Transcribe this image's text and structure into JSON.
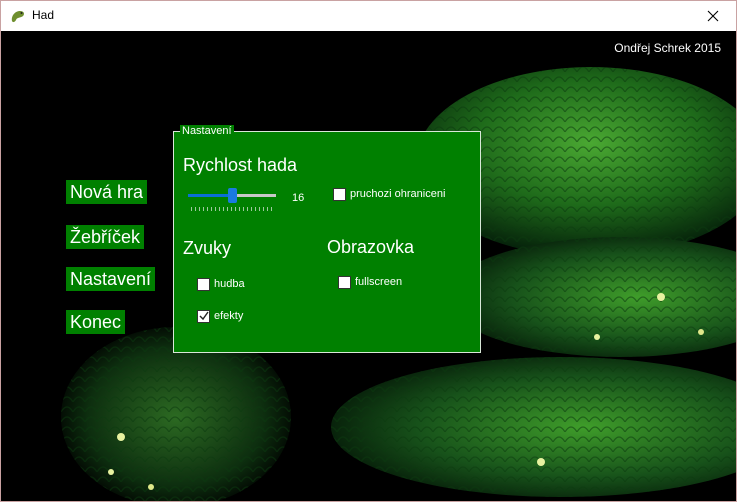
{
  "window": {
    "title": "Had",
    "close_glyph": "✕"
  },
  "author": "Ondřej Schrek 2015",
  "menu": [
    {
      "label": "Nová hra"
    },
    {
      "label": "Žebříček"
    },
    {
      "label": "Nastavení"
    },
    {
      "label": "Konec"
    }
  ],
  "settings": {
    "legend": "Nastavení",
    "speed": {
      "label": "Rychlost hada",
      "value": "16",
      "fraction": 0.5
    },
    "border_checkbox": {
      "label": "pruchozi ohraniceni",
      "checked": false
    },
    "sounds": {
      "label": "Zvuky",
      "music": {
        "label": "hudba",
        "checked": false
      },
      "effects": {
        "label": "efekty",
        "checked": true
      }
    },
    "screen": {
      "label": "Obrazovka",
      "fullscreen": {
        "label": "fullscreen",
        "checked": false
      }
    }
  },
  "colors": {
    "panel": "#008000",
    "background": "#000000",
    "accent": "#0a6fd6"
  }
}
